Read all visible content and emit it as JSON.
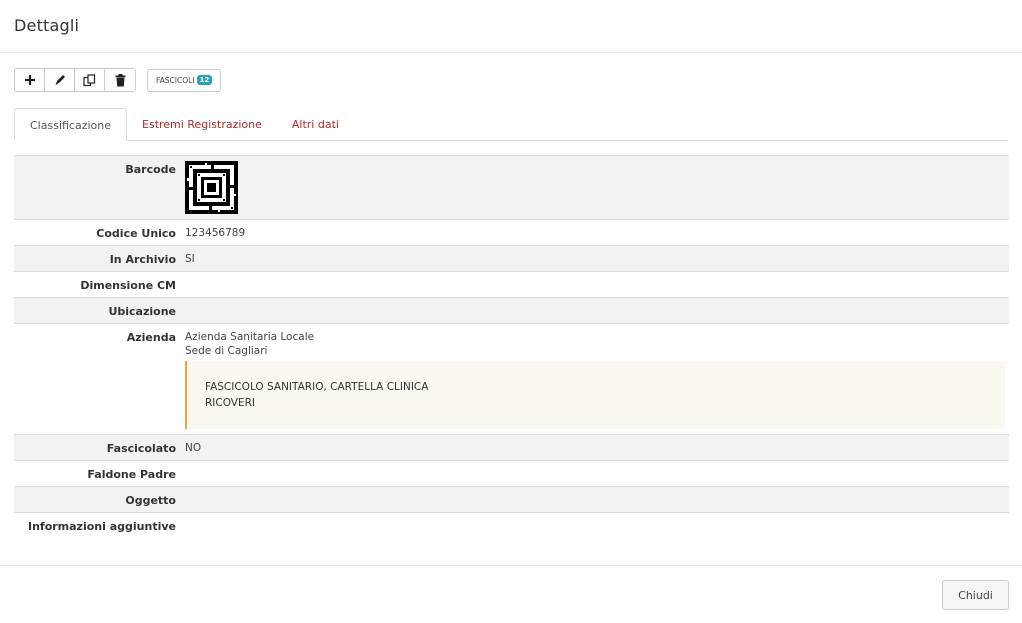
{
  "header": {
    "title": "Dettagli"
  },
  "toolbar": {
    "buttons": [
      "plus-icon",
      "pencil-icon",
      "copy-icon",
      "trash-icon"
    ],
    "fascicoli_label": "FASCICOLI",
    "fascicoli_count": "12"
  },
  "tabs": [
    {
      "label": "Classificazione",
      "active": true
    },
    {
      "label": "Estremi Registrazione",
      "active": false
    },
    {
      "label": "Altri dati",
      "active": false
    }
  ],
  "fields": {
    "barcode": {
      "label": "Barcode"
    },
    "codice_unico": {
      "label": "Codice Unico",
      "value": "123456789"
    },
    "in_archivio": {
      "label": "In Archivio",
      "value": "SI"
    },
    "dimensione_cm": {
      "label": "Dimensione CM",
      "value": ""
    },
    "ubicazione": {
      "label": "Ubicazione",
      "value": ""
    },
    "azienda": {
      "label": "Azienda",
      "line1": "Azienda Sanitaria Locale",
      "line2": "Sede di Cagliari",
      "note_line1": "FASCICOLO SANITARIO, CARTELLA CLINICA",
      "note_line2": "RICOVERI"
    },
    "fascicolato": {
      "label": "Fascicolato",
      "value": "NO"
    },
    "faldone_padre": {
      "label": "Faldone Padre",
      "value": ""
    },
    "oggetto": {
      "label": "Oggetto",
      "value": ""
    },
    "informazioni_aggiuntive": {
      "label": "Informazioni aggiuntive",
      "value": ""
    }
  },
  "footer": {
    "close_label": "Chiudi"
  },
  "colors": {
    "accent_red": "#b22a2a",
    "badge": "#2aa3b8",
    "note_border": "#f0a53a"
  }
}
